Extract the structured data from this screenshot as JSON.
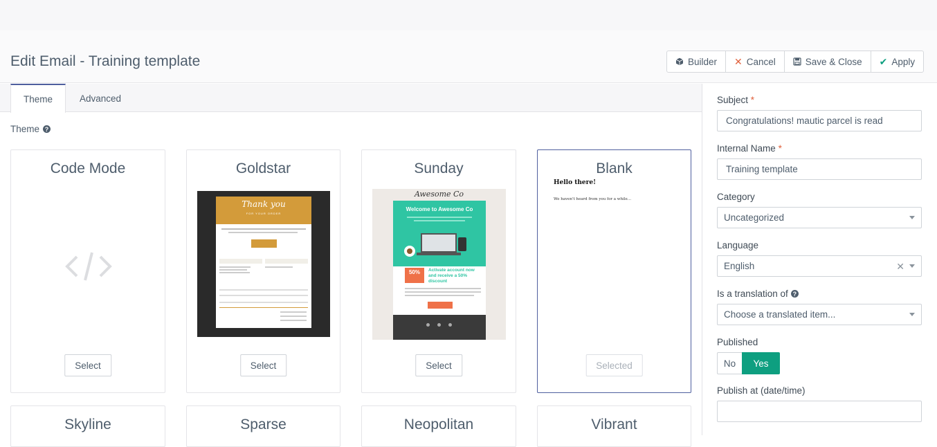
{
  "header": {
    "title": "Edit Email - Training template",
    "buttons": {
      "builder": "Builder",
      "cancel": "Cancel",
      "save_close": "Save & Close",
      "apply": "Apply"
    }
  },
  "tabs": [
    {
      "label": "Theme"
    },
    {
      "label": "Advanced"
    }
  ],
  "theme_section": {
    "label": "Theme"
  },
  "themes": [
    {
      "name": "Code Mode",
      "button": "Select"
    },
    {
      "name": "Goldstar",
      "button": "Select"
    },
    {
      "name": "Sunday",
      "button": "Select"
    },
    {
      "name": "Blank",
      "button": "Selected"
    },
    {
      "name": "Skyline"
    },
    {
      "name": "Sparse"
    },
    {
      "name": "Neopolitan"
    },
    {
      "name": "Vibrant"
    }
  ],
  "previews": {
    "goldstar": {
      "heading": "Thank you",
      "sub": "FOR YOUR ORDER"
    },
    "sunday": {
      "brand": "Awesome Co",
      "banner": "Welcome to Awesome Co",
      "badge": "50%",
      "promo": "Activate account now and receive a 50% discount"
    },
    "blank": {
      "heading": "Hello there!",
      "body": "We haven't heard from you for a while..."
    }
  },
  "form": {
    "subject_label": "Subject",
    "subject_value": "Congratulations! mautic parcel is read",
    "internal_name_label": "Internal Name",
    "internal_name_value": "Training template",
    "category_label": "Category",
    "category_value": "Uncategorized",
    "language_label": "Language",
    "language_value": "English",
    "translation_label": "Is a translation of",
    "translation_placeholder": "Choose a translated item...",
    "published_label": "Published",
    "published_no": "No",
    "published_yes": "Yes",
    "publish_at_label": "Publish at (date/time)",
    "publish_at_value": "",
    "required_mark": "*"
  },
  "colors": {
    "accent": "#4e5e9e",
    "success": "#0e9f80",
    "danger": "#e0613c"
  }
}
